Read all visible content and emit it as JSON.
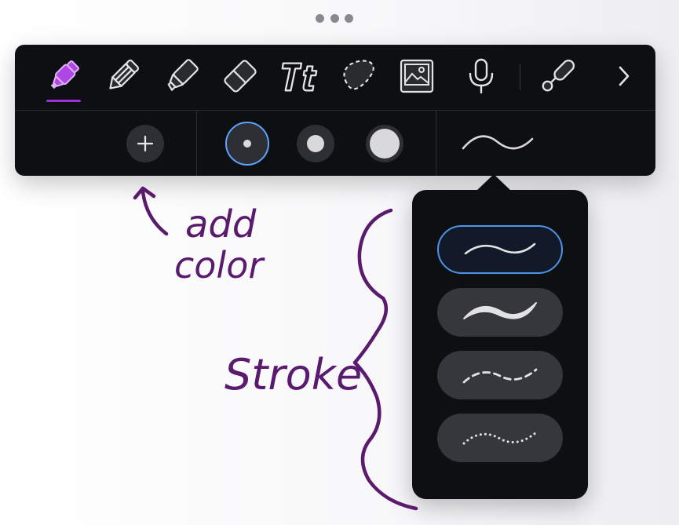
{
  "toolbar": {
    "tools": [
      {
        "name": "marker",
        "icon": "marker-icon",
        "selected": true
      },
      {
        "name": "pencil",
        "icon": "pencil-icon",
        "selected": false
      },
      {
        "name": "highlighter",
        "icon": "highlighter-icon",
        "selected": false
      },
      {
        "name": "eraser",
        "icon": "eraser-icon",
        "selected": false
      },
      {
        "name": "text",
        "icon": "text-tool-icon",
        "label": "Tt",
        "selected": false
      },
      {
        "name": "lasso",
        "icon": "lasso-icon",
        "selected": false
      },
      {
        "name": "image",
        "icon": "image-icon",
        "selected": false
      },
      {
        "name": "audio",
        "icon": "microphone-icon",
        "selected": false
      },
      {
        "name": "link",
        "icon": "link-icon",
        "selected": false
      },
      {
        "name": "more",
        "icon": "chevron-right-icon",
        "selected": false
      }
    ],
    "add_color": {
      "icon": "plus-icon",
      "label": "+"
    },
    "sizes": [
      {
        "name": "small",
        "selected": true
      },
      {
        "name": "medium",
        "selected": false
      },
      {
        "name": "large",
        "selected": false
      }
    ],
    "stroke_preview_icon": "stroke-wave-icon"
  },
  "stroke_popover": {
    "options": [
      {
        "name": "thin-solid",
        "selected": true
      },
      {
        "name": "tapered-solid",
        "selected": false
      },
      {
        "name": "dashed",
        "selected": false
      },
      {
        "name": "dotted",
        "selected": false
      }
    ]
  },
  "annotations": {
    "add_color_line1": "add",
    "add_color_line2": "color",
    "stroke_label": "Stroke"
  },
  "colors": {
    "accent_purple": "#9b30d9",
    "ink_purple": "#5a1a6e",
    "selection_blue": "#5aa4ff",
    "panel_bg": "#0e0f12",
    "button_bg": "#2e2f34"
  }
}
